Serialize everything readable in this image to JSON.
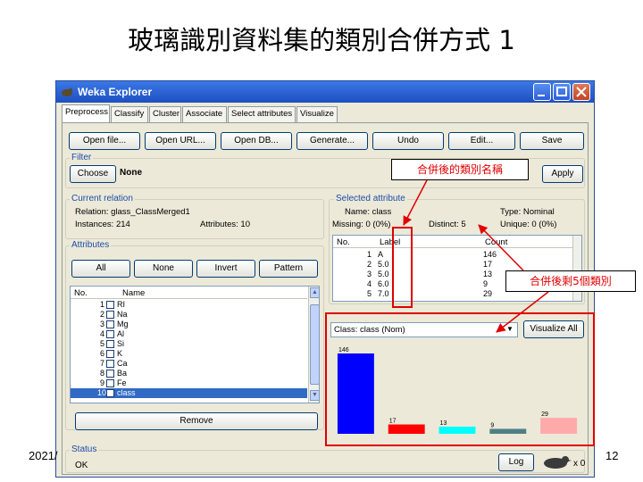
{
  "slide": {
    "title": "玻璃識別資料集的類別合併方式 1",
    "date": "2021/",
    "page_number": "12"
  },
  "window": {
    "title": "Weka Explorer",
    "tabs": [
      "Preprocess",
      "Classify",
      "Cluster",
      "Associate",
      "Select attributes",
      "Visualize"
    ],
    "toolbar": [
      "Open file...",
      "Open URL...",
      "Open DB...",
      "Generate...",
      "Undo",
      "Edit...",
      "Save"
    ],
    "filter": {
      "label": "Filter",
      "choose": "Choose",
      "value": "None",
      "apply": "Apply"
    },
    "current_relation": {
      "label": "Current relation",
      "relation": "Relation: glass_ClassMerged1",
      "instances": "Instances: 214",
      "attributes": "Attributes: 10"
    },
    "attributes": {
      "label": "Attributes",
      "buttons": [
        "All",
        "None",
        "Invert",
        "Pattern"
      ],
      "columns": [
        "No.",
        "Name"
      ],
      "rows": [
        {
          "no": "1",
          "name": "RI"
        },
        {
          "no": "2",
          "name": "Na"
        },
        {
          "no": "3",
          "name": "Mg"
        },
        {
          "no": "4",
          "name": "Al"
        },
        {
          "no": "5",
          "name": "Si"
        },
        {
          "no": "6",
          "name": "K"
        },
        {
          "no": "7",
          "name": "Ca"
        },
        {
          "no": "8",
          "name": "Ba"
        },
        {
          "no": "9",
          "name": "Fe"
        },
        {
          "no": "10",
          "name": "class"
        }
      ],
      "remove": "Remove"
    },
    "selected_attribute": {
      "label": "Selected attribute",
      "name": "Name: class",
      "type": "Type: Nominal",
      "missing": "Missing: 0 (0%)",
      "distinct": "Distinct: 5",
      "unique": "Unique: 0 (0%)",
      "columns": [
        "No.",
        "Label",
        "Count"
      ],
      "rows": [
        {
          "no": "1",
          "label": "A",
          "count": "146"
        },
        {
          "no": "2",
          "label": "5.0",
          "count": "17"
        },
        {
          "no": "3",
          "label": "5.0",
          "count": "13"
        },
        {
          "no": "4",
          "label": "6.0",
          "count": "9"
        },
        {
          "no": "5",
          "label": "7.0",
          "count": "29"
        }
      ]
    },
    "class_select": "Class: class (Nom)",
    "visualize_all": "Visualize All",
    "histogram": [
      {
        "value": 146,
        "label": "146",
        "color": "#0000ff"
      },
      {
        "value": 17,
        "label": "17",
        "color": "#ff0000"
      },
      {
        "value": 13,
        "label": "13",
        "color": "#00ffff"
      },
      {
        "value": 9,
        "label": "9",
        "color": "#4f7f86"
      },
      {
        "value": 29,
        "label": "29",
        "color": "#ffaaaa"
      }
    ],
    "status": {
      "label": "Status",
      "text": "OK",
      "log": "Log",
      "x_count": "x 0"
    }
  },
  "annotations": {
    "class_names_after_merge": "合併後的類別名稱",
    "five_classes_left": "合併後剩5個類別"
  },
  "colors": {
    "callout_text": "#e00000",
    "titlebar": "#1e4fc1",
    "selected_row": "#316ac5"
  }
}
